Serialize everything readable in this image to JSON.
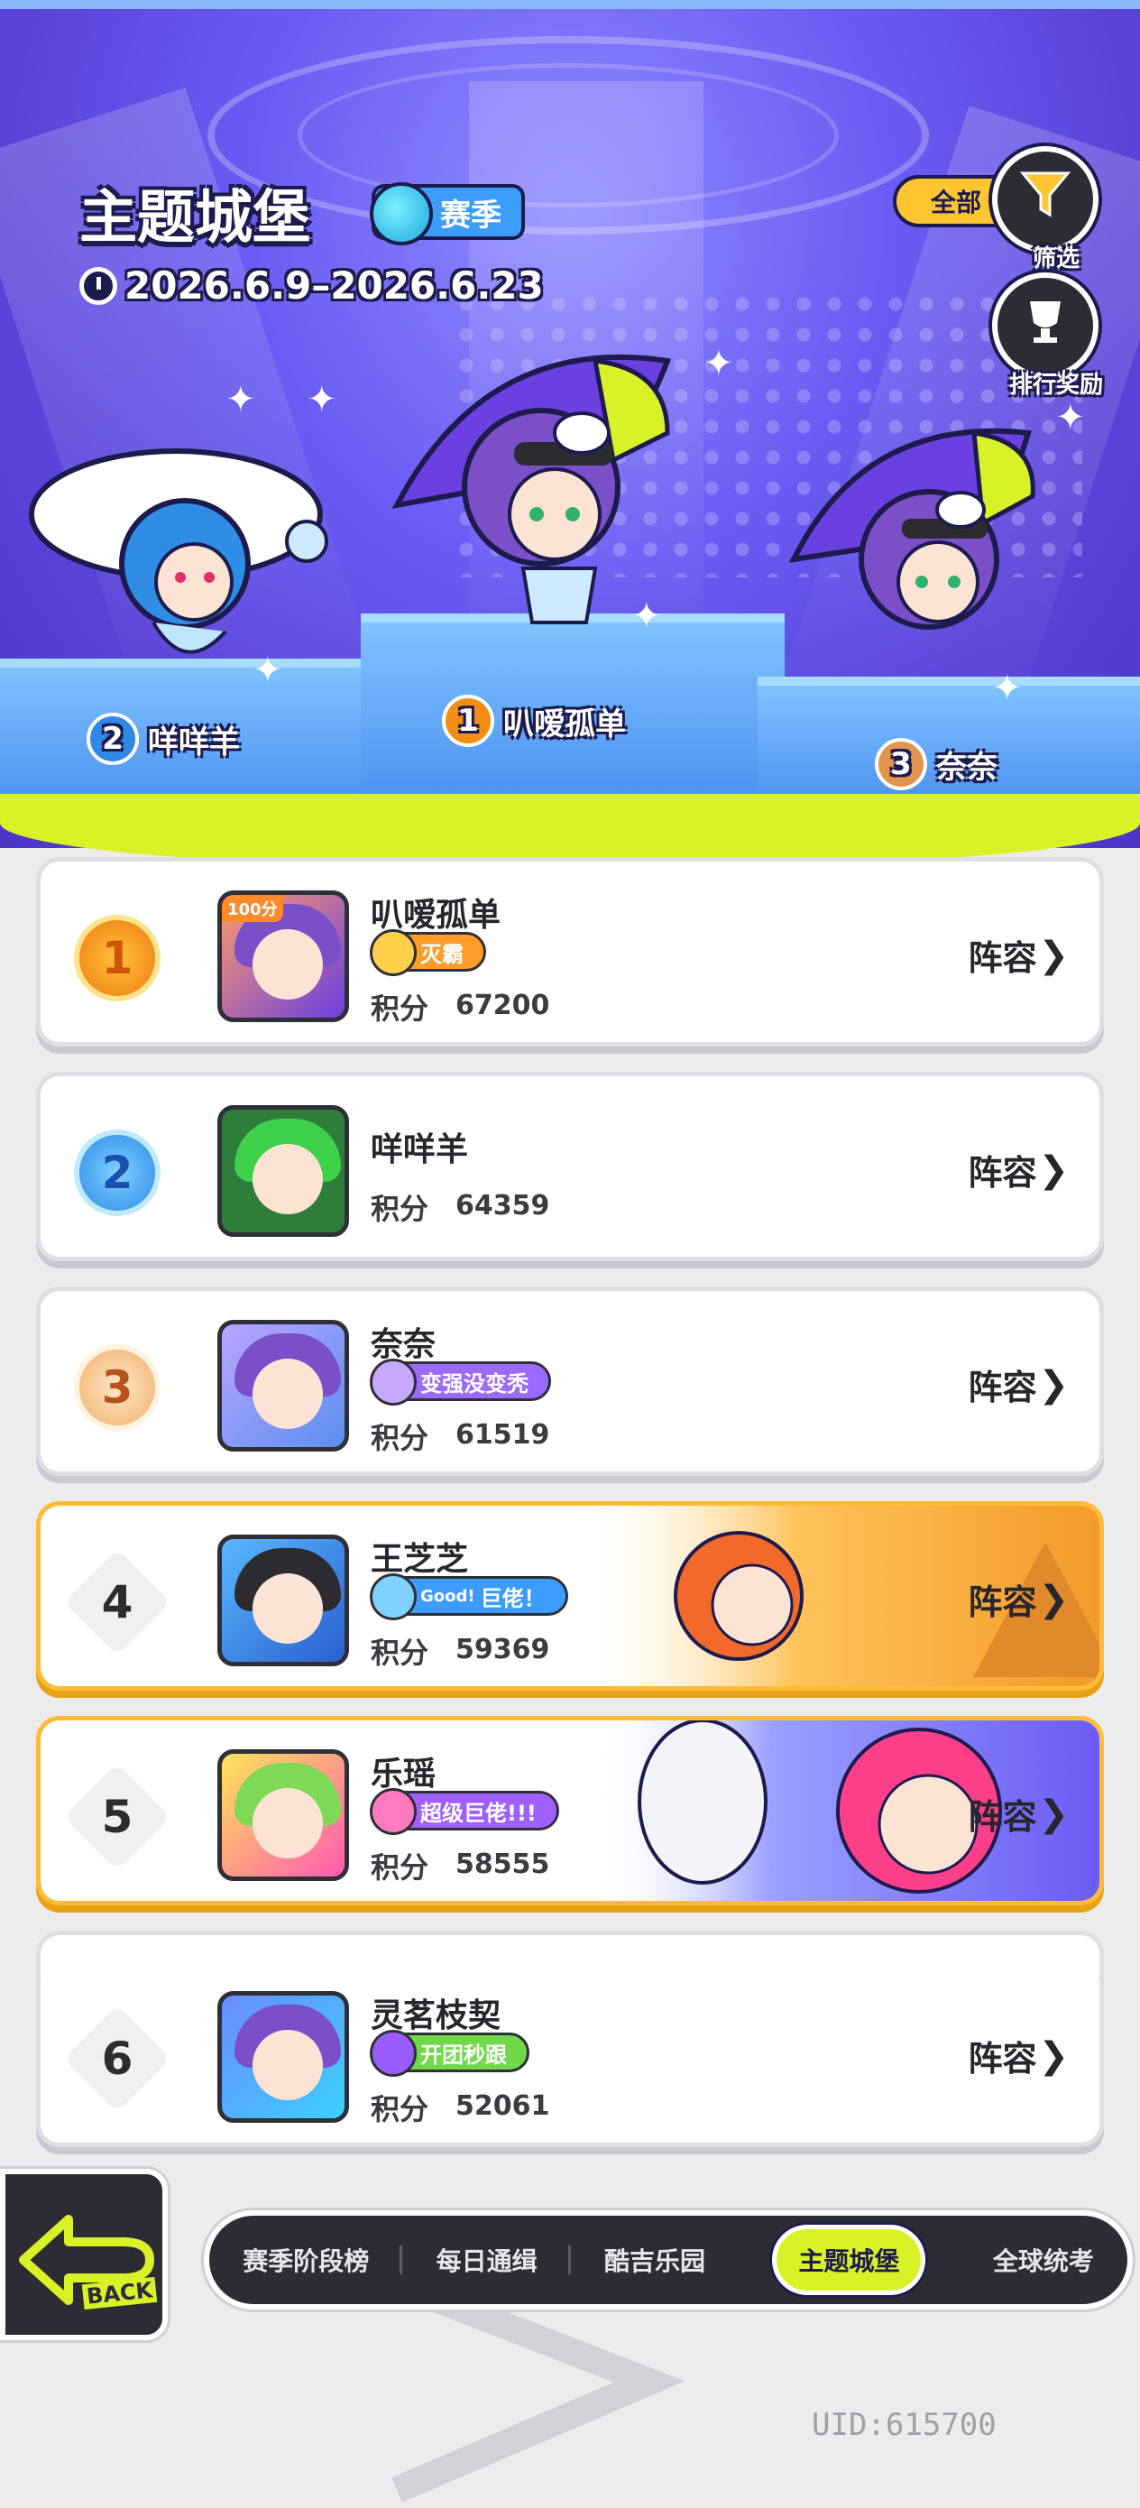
{
  "header": {
    "title": "主题城堡",
    "season_badge": "赛季",
    "date_range": "2026.6.9–2026.6.23",
    "filter_pill": "全部",
    "filter_label": "筛选",
    "rewards_label": "排行奖励"
  },
  "podium": {
    "first": {
      "rank": "1",
      "name": "叭嗳孤单"
    },
    "second": {
      "rank": "2",
      "name": "咩咩羊"
    },
    "third": {
      "rank": "3",
      "name": "奈奈"
    }
  },
  "ranking": {
    "score_label": "积分",
    "lineup_label": "阵容",
    "rows": [
      {
        "rank": "1",
        "name": "叭嗳孤单",
        "tag": "灭霸",
        "score": "67200",
        "avatar_badge": "100分"
      },
      {
        "rank": "2",
        "name": "咩咩羊",
        "tag": "",
        "score": "64359"
      },
      {
        "rank": "3",
        "name": "奈奈",
        "tag": "变强没变秃",
        "score": "61519"
      },
      {
        "rank": "4",
        "name": "王芝芝",
        "tag": "巨佬！",
        "tag_prefix": "Good!",
        "score": "59369"
      },
      {
        "rank": "5",
        "name": "乐瑶",
        "tag": "超级巨佬!!!",
        "score": "58555"
      },
      {
        "rank": "6",
        "name": "灵茗枝契",
        "tag": "开团秒跟",
        "score": "52061"
      }
    ]
  },
  "navigation": {
    "back_label": "BACK",
    "tabs": [
      "赛季阶段榜",
      "每日通缉",
      "酷吉乐园",
      "主题城堡",
      "全球统考"
    ],
    "active_tab": "主题城堡"
  },
  "footer": {
    "uid": "UID:615700"
  },
  "colors": {
    "accent_lime": "#d9f227",
    "gold_border": "#ffbc34",
    "hero_purple": "#6a5cf3",
    "dark": "#2c2c34"
  }
}
